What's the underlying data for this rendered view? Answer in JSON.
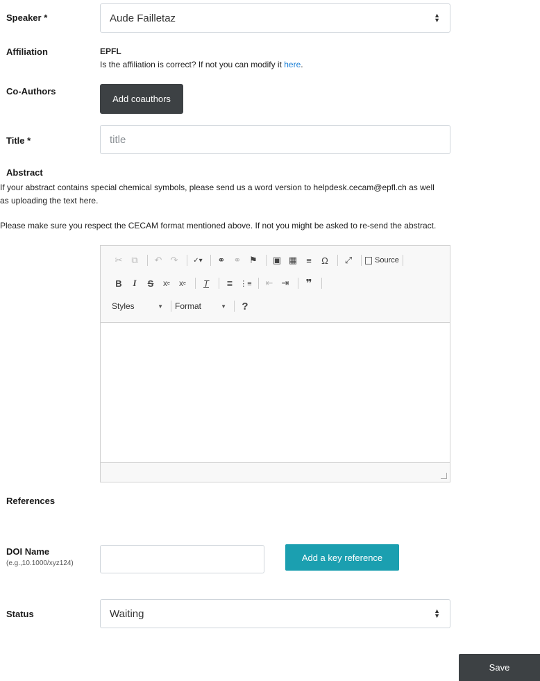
{
  "speaker": {
    "label": "Speaker",
    "value": "Aude Failletaz"
  },
  "affiliation": {
    "label": "Affiliation",
    "value": "EPFL",
    "note_prefix": "Is the affiliation is correct? If not you can modify it ",
    "note_link": "here",
    "note_suffix": "."
  },
  "coauthors": {
    "label": "Co-Authors",
    "button": "Add coauthors"
  },
  "title_field": {
    "label": "Title",
    "placeholder": "title"
  },
  "abstract": {
    "label": "Abstract",
    "info_line1": "If your abstract contains special chemical symbols, please send us a word version to helpdesk.cecam@epfl.ch as well",
    "info_line2": "as uploading the text here.",
    "format_note": "Please make sure you respect the CECAM format mentioned above. If not you might be asked to re-send the abstract."
  },
  "editor": {
    "source_label": "Source",
    "styles_label": "Styles",
    "format_label": "Format"
  },
  "references": {
    "label": "References"
  },
  "doi": {
    "label": "DOI Name",
    "hint": "(e.g.,10.1000/xyz124)",
    "value": "",
    "button": "Add a key reference"
  },
  "status": {
    "label": "Status",
    "value": "Waiting"
  },
  "save": {
    "label": "Save"
  },
  "colors": {
    "teal_button": "#1b9fb0",
    "dark_button": "#3d4144",
    "link": "#1a7fd6"
  }
}
